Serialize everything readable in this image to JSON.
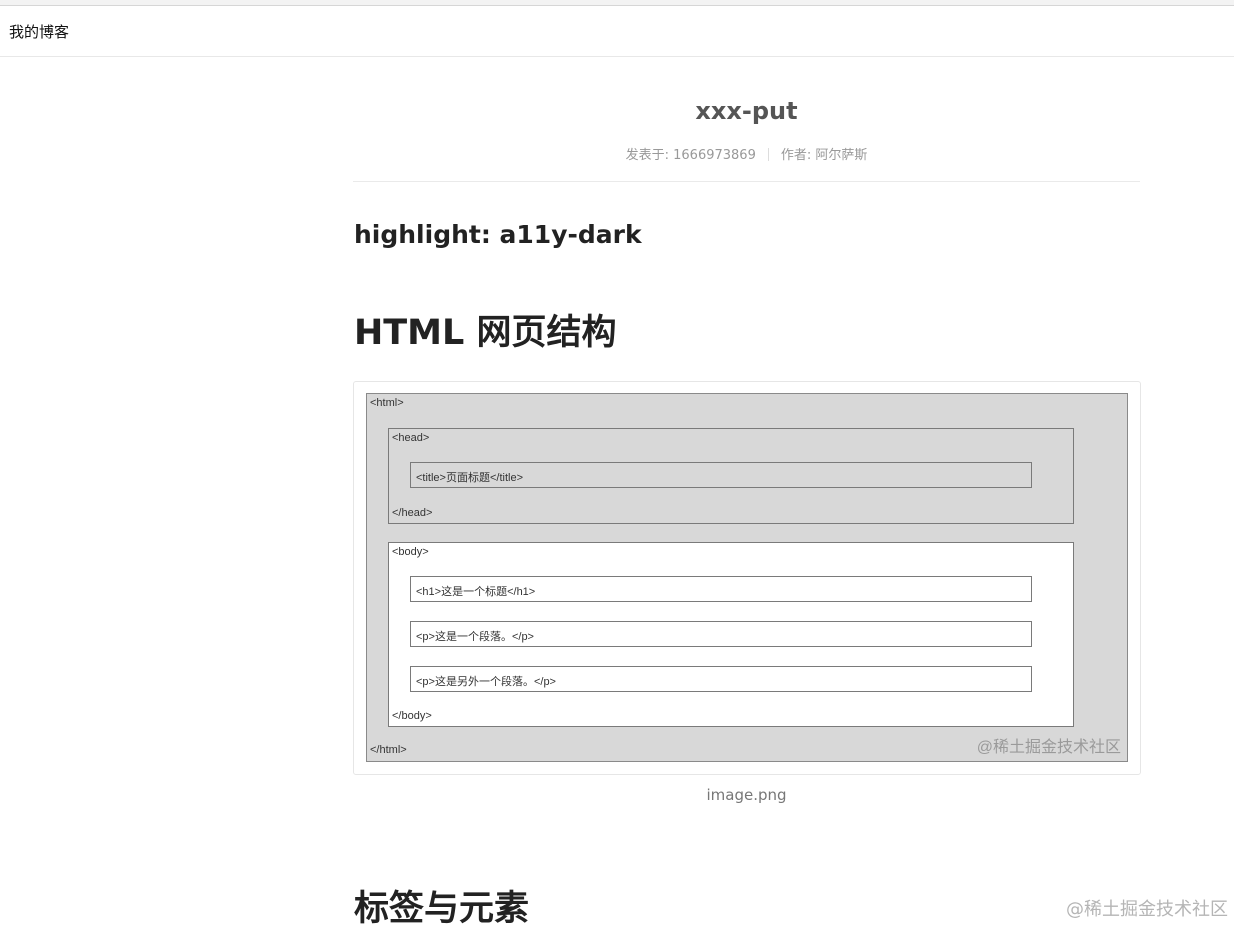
{
  "site": {
    "brand": "我的博客"
  },
  "post": {
    "title": "xxx-put",
    "meta": {
      "published": "发表于: 1666973869",
      "author": "作者: 阿尔萨斯"
    }
  },
  "content": {
    "highlight_heading": "highlight: a11y-dark",
    "section1_heading": "HTML 网页结构",
    "figure": {
      "html_open": "<html>",
      "head_open": "<head>",
      "title_line": "<title>页面标题</title>",
      "head_close": "</head>",
      "body_open": "<body>",
      "h1_line": "<h1>这是一个标题</h1>",
      "p1_line": "<p>这是一个段落。</p>",
      "p2_line": "<p>这是另外一个段落。</p>",
      "body_close": "</body>",
      "html_close": "</html>",
      "watermark": "@稀土掘金技术社区",
      "caption": "image.png"
    },
    "section2_heading": "标签与元素"
  },
  "page_watermark": "@稀土掘金技术社区"
}
